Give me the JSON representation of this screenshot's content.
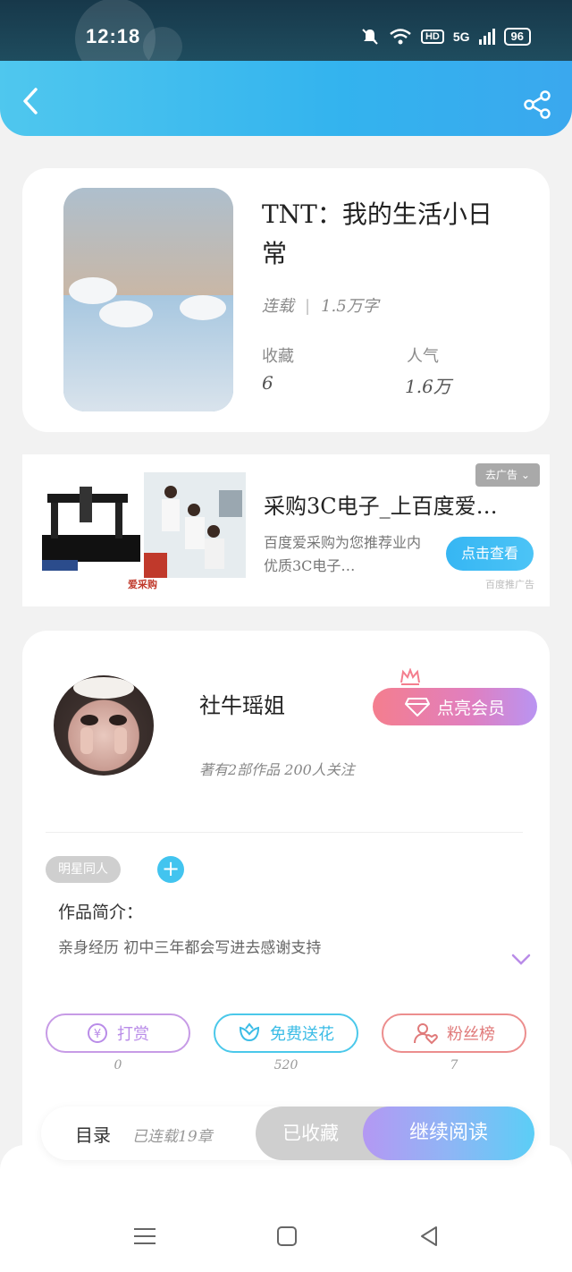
{
  "status_bar": {
    "time": "12:18",
    "network": "5G",
    "hd": "HD",
    "battery": "96"
  },
  "header": {
    "back_icon": "chevron-left-icon",
    "share_icon": "share-icon",
    "background_color": "#33b3ee"
  },
  "book": {
    "title": "TNT：我的生活小日常",
    "status": "连载",
    "word_count": "1.5万字",
    "stats": [
      {
        "label": "收藏",
        "value": "6"
      },
      {
        "label": "人气",
        "value": "1.6万"
      }
    ]
  },
  "ad": {
    "brand": "爱采购",
    "title": "采购3C电子_上百度爱…",
    "description": "百度爱采购为您推荐业内优质3C电子…",
    "tag": "去广告",
    "cta": "点击查看",
    "source": "百度推广告"
  },
  "author": {
    "name": "社牛瑶姐",
    "subtitle": "著有2部作品 200人关注",
    "vip_label": "点亮会员"
  },
  "intro": {
    "tag": "明星同人",
    "label": "作品简介：",
    "text": "亲身经历 初中三年都会写进去感谢支持"
  },
  "actions": [
    {
      "label": "打赏",
      "count": "0",
      "color": "#c79be6",
      "icon": "yen-icon"
    },
    {
      "label": "免费送花",
      "count": "520",
      "color": "#4bc8ea",
      "icon": "flower-icon"
    },
    {
      "label": "粉丝榜",
      "count": "7",
      "color": "#ec8e8e",
      "icon": "fan-icon"
    }
  ],
  "bottom_bar": {
    "toc": "目录",
    "toc_status": "已连载19章",
    "collected": "已收藏",
    "continue": "继续阅读"
  },
  "nav": {
    "menu_icon": "menu-icon",
    "home_icon": "home-square-icon",
    "back_icon": "back-triangle-icon"
  }
}
